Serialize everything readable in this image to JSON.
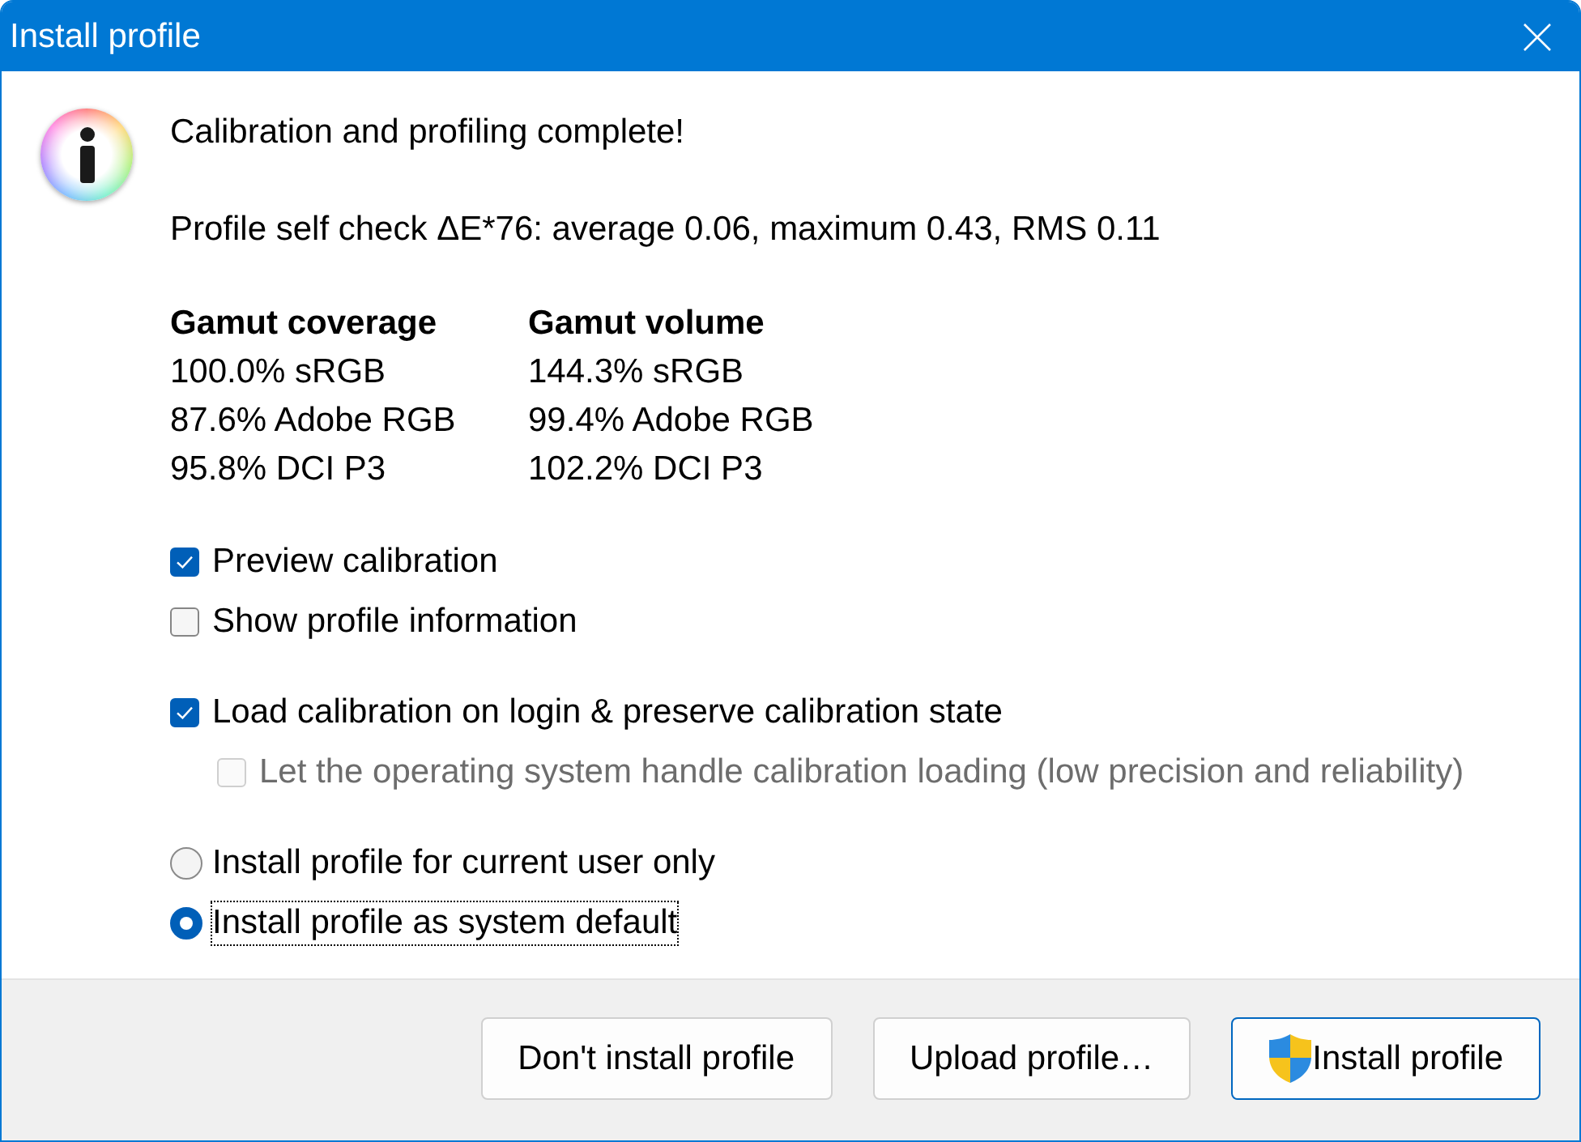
{
  "window": {
    "title": "Install profile"
  },
  "message": {
    "heading": "Calibration and profiling complete!",
    "self_check": "Profile self check ΔE*76: average 0.06, maximum 0.43, RMS 0.11"
  },
  "gamut": {
    "columns": [
      {
        "heading": "Gamut coverage",
        "values": [
          "100.0% sRGB",
          "87.6% Adobe RGB",
          "95.8% DCI P3"
        ]
      },
      {
        "heading": "Gamut volume",
        "values": [
          "144.3% sRGB",
          "99.4% Adobe RGB",
          "102.2% DCI P3"
        ]
      }
    ]
  },
  "option_groups": [
    {
      "items": [
        {
          "kind": "checkbox",
          "label": "Preview calibration",
          "checked": true,
          "disabled": false
        },
        {
          "kind": "checkbox",
          "label": "Show profile information",
          "checked": false,
          "disabled": false
        }
      ]
    },
    {
      "items": [
        {
          "kind": "checkbox",
          "label": "Load calibration on login & preserve calibration state",
          "checked": true,
          "disabled": false,
          "children": [
            {
              "kind": "checkbox",
              "label": "Let the operating system handle calibration loading (low precision and reliability)",
              "checked": false,
              "disabled": true
            }
          ]
        }
      ]
    },
    {
      "items": [
        {
          "kind": "radio",
          "label": "Install profile for current user only",
          "selected": false,
          "focused": false
        },
        {
          "kind": "radio",
          "label": "Install profile as system default",
          "selected": true,
          "focused": true
        }
      ]
    }
  ],
  "buttons": [
    {
      "label": "Don't install profile",
      "default": false,
      "elevated": false
    },
    {
      "label": "Upload profile…",
      "default": false,
      "elevated": false
    },
    {
      "label": "Install profile",
      "default": true,
      "elevated": true
    }
  ]
}
